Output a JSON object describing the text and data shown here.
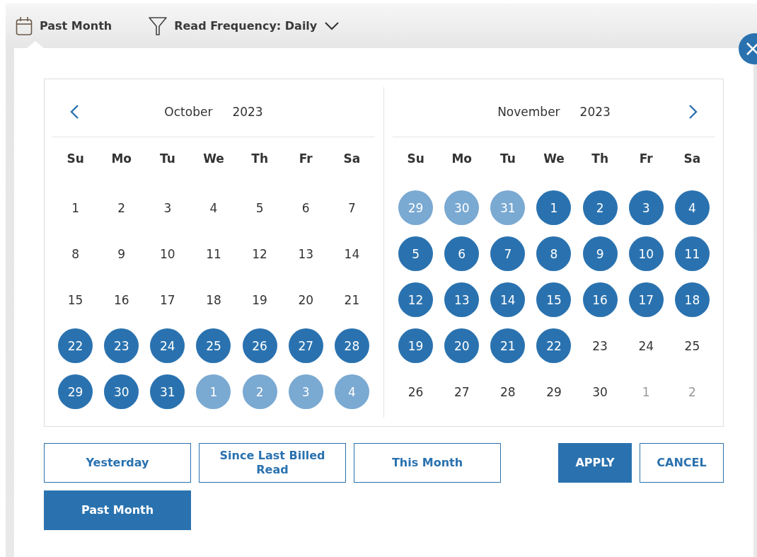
{
  "toolbar": {
    "date_filter": "Past Month",
    "frequency_filter": "Read Frequency: Daily"
  },
  "calendars": [
    {
      "month": "October",
      "year": "2023",
      "kind": "prev",
      "weekdays": [
        "Su",
        "Mo",
        "Tu",
        "We",
        "Th",
        "Fr",
        "Sa"
      ],
      "days": [
        {
          "label": "1",
          "selected": false,
          "outside": false
        },
        {
          "label": "2",
          "selected": false,
          "outside": false
        },
        {
          "label": "3",
          "selected": false,
          "outside": false
        },
        {
          "label": "4",
          "selected": false,
          "outside": false
        },
        {
          "label": "5",
          "selected": false,
          "outside": false
        },
        {
          "label": "6",
          "selected": false,
          "outside": false
        },
        {
          "label": "7",
          "selected": false,
          "outside": false
        },
        {
          "label": "8",
          "selected": false,
          "outside": false
        },
        {
          "label": "9",
          "selected": false,
          "outside": false
        },
        {
          "label": "10",
          "selected": false,
          "outside": false
        },
        {
          "label": "11",
          "selected": false,
          "outside": false
        },
        {
          "label": "12",
          "selected": false,
          "outside": false
        },
        {
          "label": "13",
          "selected": false,
          "outside": false
        },
        {
          "label": "14",
          "selected": false,
          "outside": false
        },
        {
          "label": "15",
          "selected": false,
          "outside": false
        },
        {
          "label": "16",
          "selected": false,
          "outside": false
        },
        {
          "label": "17",
          "selected": false,
          "outside": false
        },
        {
          "label": "18",
          "selected": false,
          "outside": false
        },
        {
          "label": "19",
          "selected": false,
          "outside": false
        },
        {
          "label": "20",
          "selected": false,
          "outside": false
        },
        {
          "label": "21",
          "selected": false,
          "outside": false
        },
        {
          "label": "22",
          "selected": true,
          "outside": false
        },
        {
          "label": "23",
          "selected": true,
          "outside": false
        },
        {
          "label": "24",
          "selected": true,
          "outside": false
        },
        {
          "label": "25",
          "selected": true,
          "outside": false
        },
        {
          "label": "26",
          "selected": true,
          "outside": false
        },
        {
          "label": "27",
          "selected": true,
          "outside": false
        },
        {
          "label": "28",
          "selected": true,
          "outside": false
        },
        {
          "label": "29",
          "selected": true,
          "outside": false
        },
        {
          "label": "30",
          "selected": true,
          "outside": false
        },
        {
          "label": "31",
          "selected": true,
          "outside": false
        },
        {
          "label": "1",
          "selected": true,
          "outside": true
        },
        {
          "label": "2",
          "selected": true,
          "outside": true
        },
        {
          "label": "3",
          "selected": true,
          "outside": true
        },
        {
          "label": "4",
          "selected": true,
          "outside": true
        }
      ]
    },
    {
      "month": "November",
      "year": "2023",
      "kind": "next",
      "weekdays": [
        "Su",
        "Mo",
        "Tu",
        "We",
        "Th",
        "Fr",
        "Sa"
      ],
      "days": [
        {
          "label": "29",
          "selected": true,
          "outside": true
        },
        {
          "label": "30",
          "selected": true,
          "outside": true
        },
        {
          "label": "31",
          "selected": true,
          "outside": true
        },
        {
          "label": "1",
          "selected": true,
          "outside": false
        },
        {
          "label": "2",
          "selected": true,
          "outside": false
        },
        {
          "label": "3",
          "selected": true,
          "outside": false
        },
        {
          "label": "4",
          "selected": true,
          "outside": false
        },
        {
          "label": "5",
          "selected": true,
          "outside": false
        },
        {
          "label": "6",
          "selected": true,
          "outside": false
        },
        {
          "label": "7",
          "selected": true,
          "outside": false
        },
        {
          "label": "8",
          "selected": true,
          "outside": false
        },
        {
          "label": "9",
          "selected": true,
          "outside": false
        },
        {
          "label": "10",
          "selected": true,
          "outside": false
        },
        {
          "label": "11",
          "selected": true,
          "outside": false
        },
        {
          "label": "12",
          "selected": true,
          "outside": false
        },
        {
          "label": "13",
          "selected": true,
          "outside": false
        },
        {
          "label": "14",
          "selected": true,
          "outside": false
        },
        {
          "label": "15",
          "selected": true,
          "outside": false
        },
        {
          "label": "16",
          "selected": true,
          "outside": false
        },
        {
          "label": "17",
          "selected": true,
          "outside": false
        },
        {
          "label": "18",
          "selected": true,
          "outside": false
        },
        {
          "label": "19",
          "selected": true,
          "outside": false
        },
        {
          "label": "20",
          "selected": true,
          "outside": false
        },
        {
          "label": "21",
          "selected": true,
          "outside": false
        },
        {
          "label": "22",
          "selected": true,
          "outside": false
        },
        {
          "label": "23",
          "selected": false,
          "outside": false
        },
        {
          "label": "24",
          "selected": false,
          "outside": false
        },
        {
          "label": "25",
          "selected": false,
          "outside": false
        },
        {
          "label": "26",
          "selected": false,
          "outside": false
        },
        {
          "label": "27",
          "selected": false,
          "outside": false
        },
        {
          "label": "28",
          "selected": false,
          "outside": false
        },
        {
          "label": "29",
          "selected": false,
          "outside": false
        },
        {
          "label": "30",
          "selected": false,
          "outside": false
        },
        {
          "label": "1",
          "selected": false,
          "outside": true
        },
        {
          "label": "2",
          "selected": false,
          "outside": true
        }
      ]
    }
  ],
  "presets": [
    {
      "label": "Yesterday",
      "selected": false
    },
    {
      "label": "Since Last Billed Read",
      "selected": false
    },
    {
      "label": "This Month",
      "selected": false
    },
    {
      "label": "Past Month",
      "selected": true
    }
  ],
  "actions": [
    {
      "label": "APPLY",
      "kind": "primary"
    },
    {
      "label": "CANCEL",
      "kind": "secondary"
    }
  ]
}
